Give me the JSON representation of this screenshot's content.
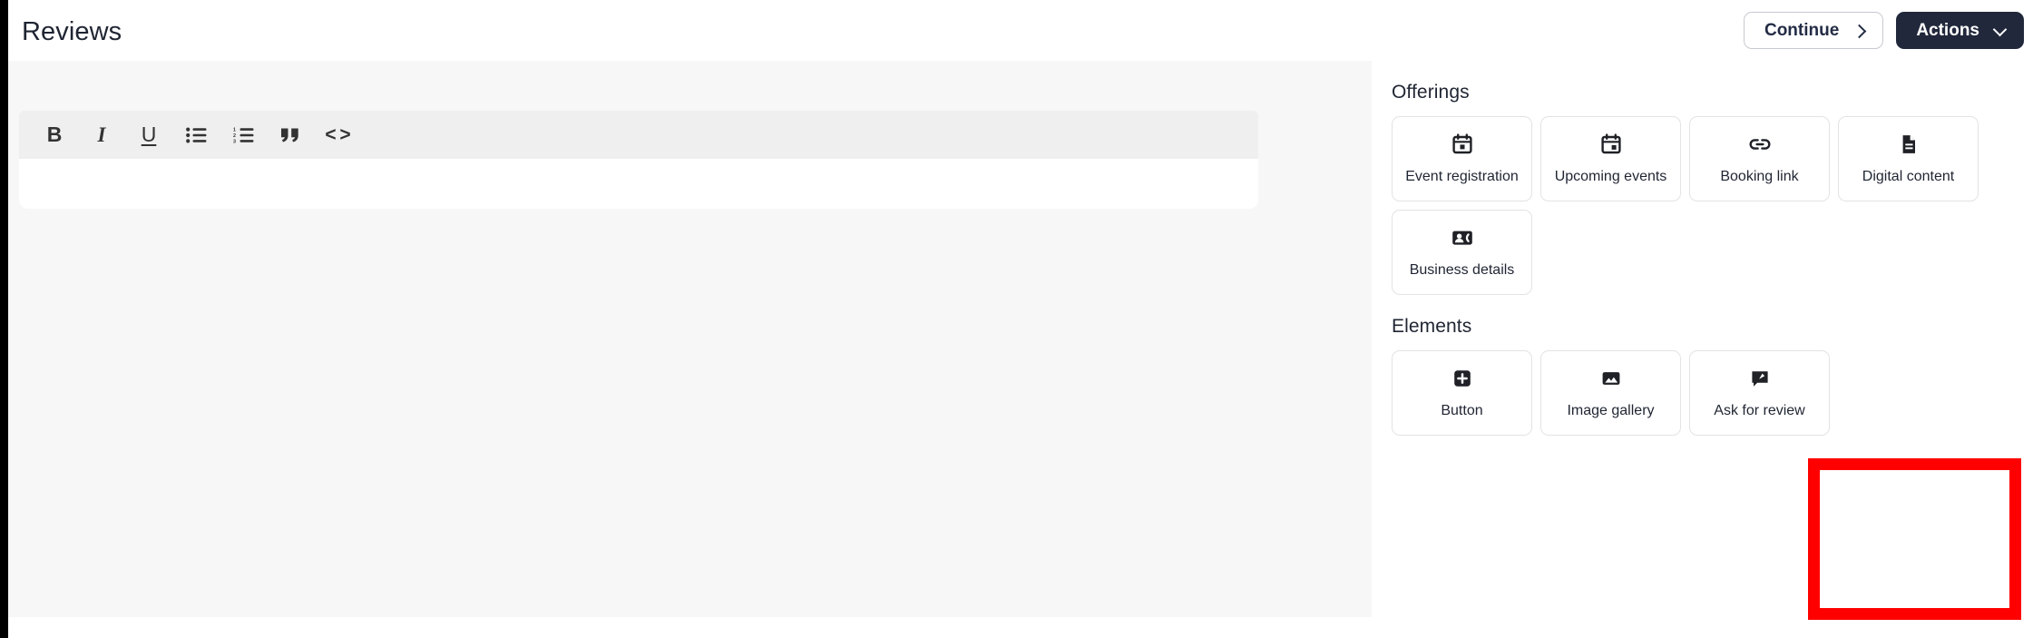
{
  "window": {
    "title": "Reviews"
  },
  "topbar": {
    "title": "Reviews",
    "continue_label": "Continue",
    "continue_icon": "chevron-right-icon",
    "actions_label": "Actions",
    "actions_icon": "chevron-down-icon"
  },
  "editor": {
    "content": "",
    "toolbar": [
      {
        "name": "bold-button",
        "glyph": "B",
        "title": "Bold"
      },
      {
        "name": "italic-button",
        "glyph": "I",
        "title": "Italic"
      },
      {
        "name": "underline-button",
        "glyph": "U",
        "title": "Underline"
      },
      {
        "name": "bulleted-list-button",
        "glyph": "",
        "title": "Bulleted list"
      },
      {
        "name": "numbered-list-button",
        "glyph": "",
        "title": "Numbered list"
      },
      {
        "name": "blockquote-button",
        "glyph": "”",
        "title": "Blockquote"
      },
      {
        "name": "code-button",
        "glyph": "< >",
        "title": "Code"
      }
    ]
  },
  "side_panel": {
    "sections": [
      {
        "heading": "Offerings",
        "cards": [
          {
            "label": "Event registration",
            "icon": "calendar-icon"
          },
          {
            "label": "Upcoming events",
            "icon": "calendar-event-icon"
          },
          {
            "label": "Booking link",
            "icon": "link-icon"
          },
          {
            "label": "Digital content",
            "icon": "document-icon"
          },
          {
            "label": "Business details",
            "icon": "contact-card-icon"
          }
        ]
      },
      {
        "heading": "Elements",
        "cards": [
          {
            "label": "Button",
            "icon": "plus-square-icon"
          },
          {
            "label": "Image gallery",
            "icon": "image-icon"
          },
          {
            "label": "Ask for review",
            "icon": "review-bubble-icon"
          }
        ]
      }
    ]
  },
  "highlight": {
    "target_label": "Ask for review",
    "color": "#fe0000"
  },
  "colors": {
    "accent_dark": "#21283b",
    "canvas_bg": "#f7f7f8",
    "toolbar_bg": "#efefef",
    "card_border": "#e2e3e5",
    "highlight": "#fe0000"
  }
}
